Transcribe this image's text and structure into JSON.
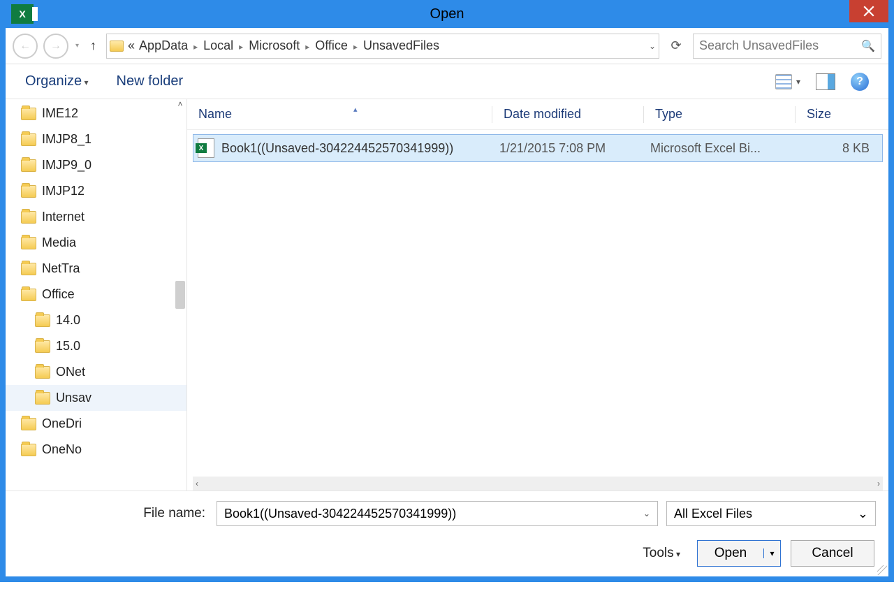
{
  "title": "Open",
  "breadcrumb": {
    "prefix": "«",
    "segments": [
      "AppData",
      "Local",
      "Microsoft",
      "Office",
      "UnsavedFiles"
    ]
  },
  "search": {
    "placeholder": "Search UnsavedFiles"
  },
  "toolbar": {
    "organize": "Organize",
    "new_folder": "New folder"
  },
  "sidebar": {
    "items": [
      {
        "label": "IME12",
        "indent": 1
      },
      {
        "label": "IMJP8_1",
        "indent": 1
      },
      {
        "label": "IMJP9_0",
        "indent": 1
      },
      {
        "label": "IMJP12",
        "indent": 1
      },
      {
        "label": "Internet",
        "indent": 1
      },
      {
        "label": "Media",
        "indent": 1
      },
      {
        "label": "NetTra",
        "indent": 1
      },
      {
        "label": "Office",
        "indent": 1
      },
      {
        "label": "14.0",
        "indent": 2
      },
      {
        "label": "15.0",
        "indent": 2
      },
      {
        "label": "ONet",
        "indent": 2
      },
      {
        "label": "Unsav",
        "indent": 2,
        "selected": true
      },
      {
        "label": "OneDri",
        "indent": 1
      },
      {
        "label": "OneNo",
        "indent": 1
      }
    ]
  },
  "columns": {
    "name": "Name",
    "date": "Date modified",
    "type": "Type",
    "size": "Size"
  },
  "files": [
    {
      "name": "Book1((Unsaved-304224452570341999))",
      "date": "1/21/2015 7:08 PM",
      "type": "Microsoft Excel Bi...",
      "size": "8 KB"
    }
  ],
  "bottom": {
    "filename_label": "File name:",
    "filename_value": "Book1((Unsaved-304224452570341999))",
    "filter": "All Excel Files",
    "tools": "Tools",
    "open": "Open",
    "cancel": "Cancel"
  }
}
